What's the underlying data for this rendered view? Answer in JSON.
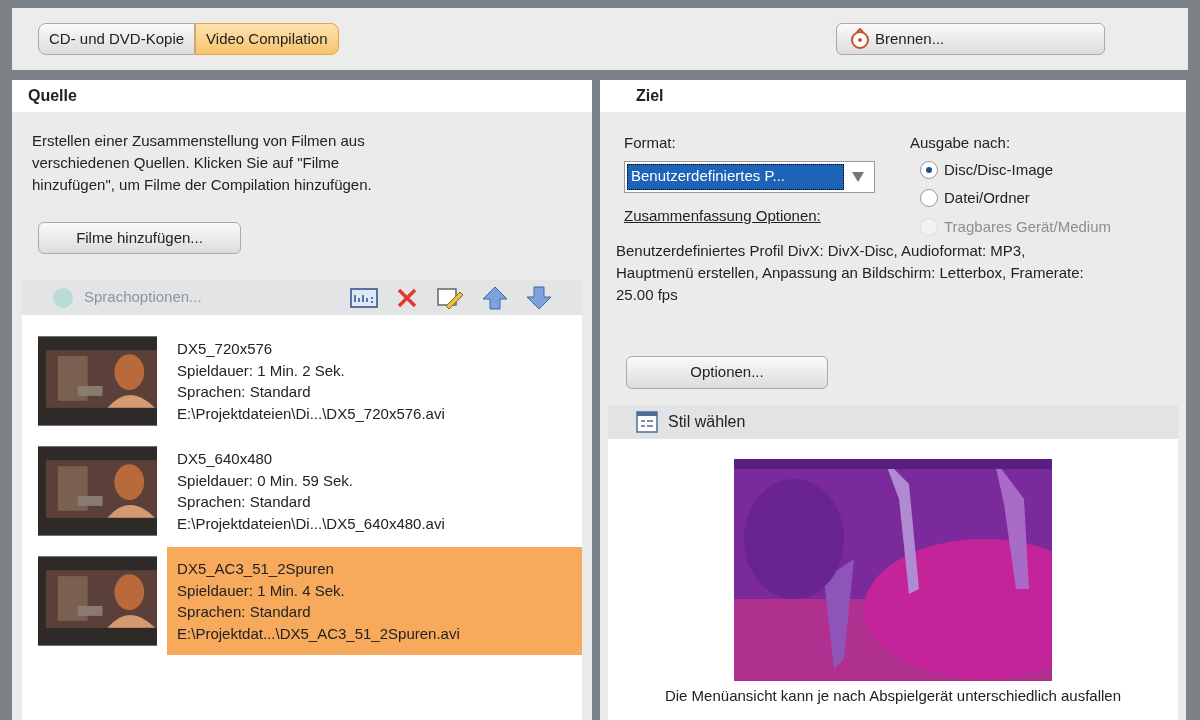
{
  "tabs": [
    {
      "label": "CD- und DVD-Kopie",
      "selected": false
    },
    {
      "label": "Video Compilation",
      "selected": true
    }
  ],
  "burn_button": "Brennen...",
  "source": {
    "title": "Quelle",
    "description": "Erstellen einer Zusammenstellung von Filmen aus verschiedenen Quellen. Klicken Sie auf \"Filme hinzufügen\", um Filme der Compilation hinzufügen.",
    "add_button": "Filme hinzufügen...",
    "language_options": {
      "label": "Sprachoptionen...",
      "disabled": true
    },
    "movies": [
      {
        "name": "DX5_720x576",
        "duration": "Spieldauer: 1 Min. 2 Sek.",
        "languages": "Sprachen: Standard",
        "path": "E:\\Projektdateien\\Di...\\DX5_720x576.avi",
        "selected": false
      },
      {
        "name": "DX5_640x480",
        "duration": "Spieldauer: 0 Min. 59 Sek.",
        "languages": "Sprachen: Standard",
        "path": "E:\\Projektdateien\\Di...\\DX5_640x480.avi",
        "selected": false
      },
      {
        "name": "DX5_AC3_51_2Spuren",
        "duration": "Spieldauer: 1 Min. 4 Sek.",
        "languages": "Sprachen: Standard",
        "path": "E:\\Projektdat...\\DX5_AC3_51_2Spuren.avi",
        "selected": true
      }
    ]
  },
  "target": {
    "title": "Ziel",
    "format_label": "Format:",
    "format_value": "Benutzerdefiniertes P...",
    "output_label": "Ausgabe nach:",
    "outputs": [
      {
        "label": "Disc/Disc-Image",
        "selected": true,
        "disabled": false
      },
      {
        "label": "Datei/Ordner",
        "selected": false,
        "disabled": false
      },
      {
        "label": "Tragbares Gerät/Medium",
        "selected": false,
        "disabled": true
      }
    ],
    "summary_label": "Zusammenfassung Optionen:",
    "summary": "Benutzerdefiniertes Profil DivX: DivX-Disc, Audioformat: MP3, Hauptmenü erstellen, Anpassung an Bildschirm: Letterbox, Framerate: 25.00 fps",
    "options_button": "Optionen...",
    "style_title": "Stil wählen",
    "note": "Die Menüansicht kann je nach Abspielgerät unterschiedlich ausfallen"
  }
}
